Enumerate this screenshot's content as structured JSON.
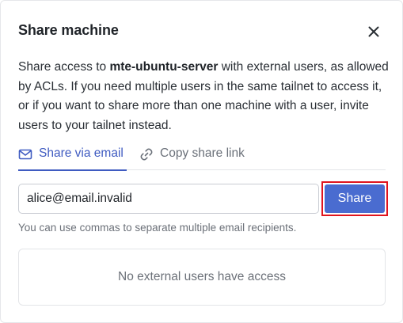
{
  "dialog": {
    "title": "Share machine",
    "close_icon": "close-icon"
  },
  "description": {
    "prefix": "Share access to ",
    "machine_name": "mte-ubuntu-server",
    "suffix": " with external users, as allowed by ACLs. If you need multiple users in the same tailnet to access it, or if you want to share more than one machine with a user, invite users to your tailnet instead."
  },
  "tabs": [
    {
      "label": "Share via email",
      "icon": "mail-icon",
      "active": true
    },
    {
      "label": "Copy share link",
      "icon": "link-icon",
      "active": false
    }
  ],
  "email_input": {
    "value": "alice@email.invalid",
    "placeholder": ""
  },
  "share_button": {
    "label": "Share"
  },
  "hint": "You can use commas to separate multiple email recipients.",
  "empty_state": "No external users have access",
  "colors": {
    "accent": "#3f5bc1",
    "button": "#4a6cd0",
    "highlight_border": "#e0141e"
  }
}
